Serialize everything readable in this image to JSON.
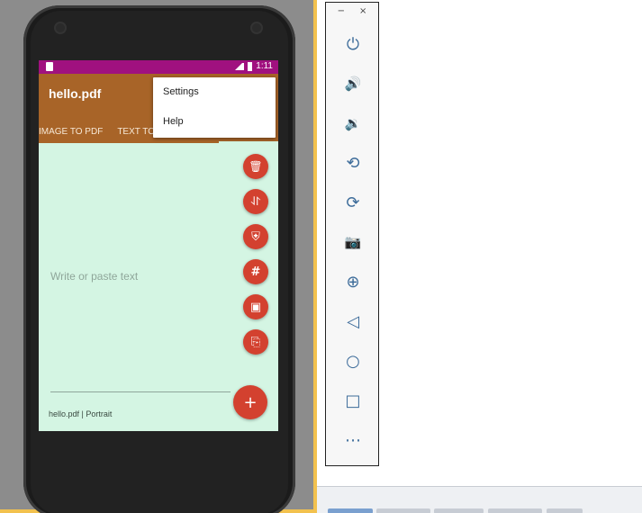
{
  "app": {
    "title": "hello.pdf",
    "status_time": "1:11",
    "tabs": [
      "IMAGE TO PDF",
      "TEXT TO P"
    ],
    "menu": [
      "Settings",
      "Help"
    ],
    "text_placeholder": "Write or paste text",
    "footer_label": "hello.pdf | Portrait",
    "fab_main": "+",
    "fabs": [
      {
        "name": "delete-icon",
        "glyph": "🗑"
      },
      {
        "name": "merge-icon",
        "glyph": "⥯"
      },
      {
        "name": "shield-icon",
        "glyph": "⛨"
      },
      {
        "name": "hash-icon",
        "glyph": "#"
      },
      {
        "name": "image-pdf-icon",
        "glyph": "▣"
      },
      {
        "name": "pdf-icon",
        "glyph": "⎘"
      }
    ],
    "nav": [
      "◀",
      "●",
      "■"
    ]
  },
  "toolbar": {
    "minimize": "−",
    "close": "×",
    "buttons": [
      {
        "name": "power-icon",
        "glyph": "⏻"
      },
      {
        "name": "volume-up-icon",
        "glyph": "🔊"
      },
      {
        "name": "volume-down-icon",
        "glyph": "🔉"
      },
      {
        "name": "rotate-left-icon",
        "glyph": "⟲"
      },
      {
        "name": "rotate-right-icon",
        "glyph": "⟳"
      },
      {
        "name": "camera-icon",
        "glyph": "📷"
      },
      {
        "name": "zoom-in-icon",
        "glyph": "⊕"
      },
      {
        "name": "back-icon",
        "glyph": "◁"
      },
      {
        "name": "home-icon",
        "glyph": "○"
      },
      {
        "name": "overview-icon",
        "glyph": "□"
      },
      {
        "name": "more-icon",
        "glyph": "⋯"
      }
    ]
  },
  "colors": {
    "status_bar": "#a0117f",
    "app_bar": "#a86428",
    "screen_bg": "#d4f5e3",
    "fab": "#d3412f",
    "toolbar_icon": "#3d6c9a"
  }
}
